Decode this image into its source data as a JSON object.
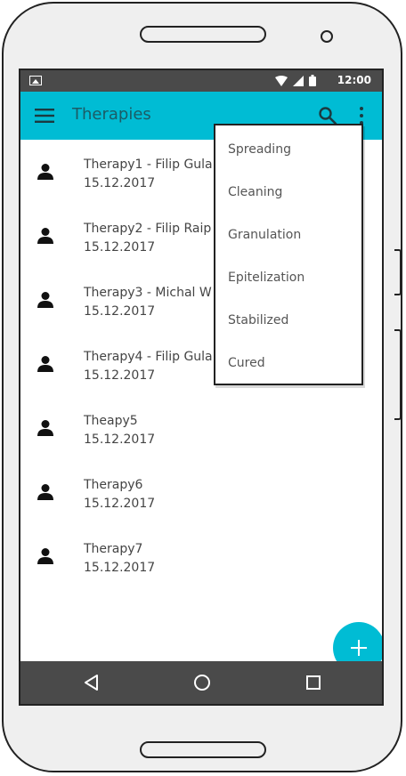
{
  "status_bar": {
    "time": "12:00"
  },
  "app_bar": {
    "title": "Therapies"
  },
  "therapies": [
    {
      "title": "Therapy1 - Filip Gula",
      "date": "15.12.2017"
    },
    {
      "title": "Therapy2 - Filip Raip",
      "date": "15.12.2017"
    },
    {
      "title": "Therapy3 - Michal W",
      "date": "15.12.2017"
    },
    {
      "title": "Therapy4 - Filip Gula",
      "date": "15.12.2017"
    },
    {
      "title": "Theapy5",
      "date": "15.12.2017"
    },
    {
      "title": "Therapy6",
      "date": "15.12.2017"
    },
    {
      "title": "Therapy7",
      "date": "15.12.2017"
    }
  ],
  "filter_menu": {
    "items": [
      "Spreading",
      "Cleaning",
      "Granulation",
      "Epitelization",
      "Stabilized",
      "Cured"
    ]
  },
  "icons": {
    "menu": "menu-icon",
    "search": "search-icon",
    "more": "more-vertical-icon",
    "person": "person-icon",
    "add": "plus-icon",
    "back": "back-triangle-icon",
    "home": "home-circle-icon",
    "recents": "recents-square-icon"
  },
  "colors": {
    "accent": "#00bcd4",
    "bars": "#4a4a4a"
  }
}
